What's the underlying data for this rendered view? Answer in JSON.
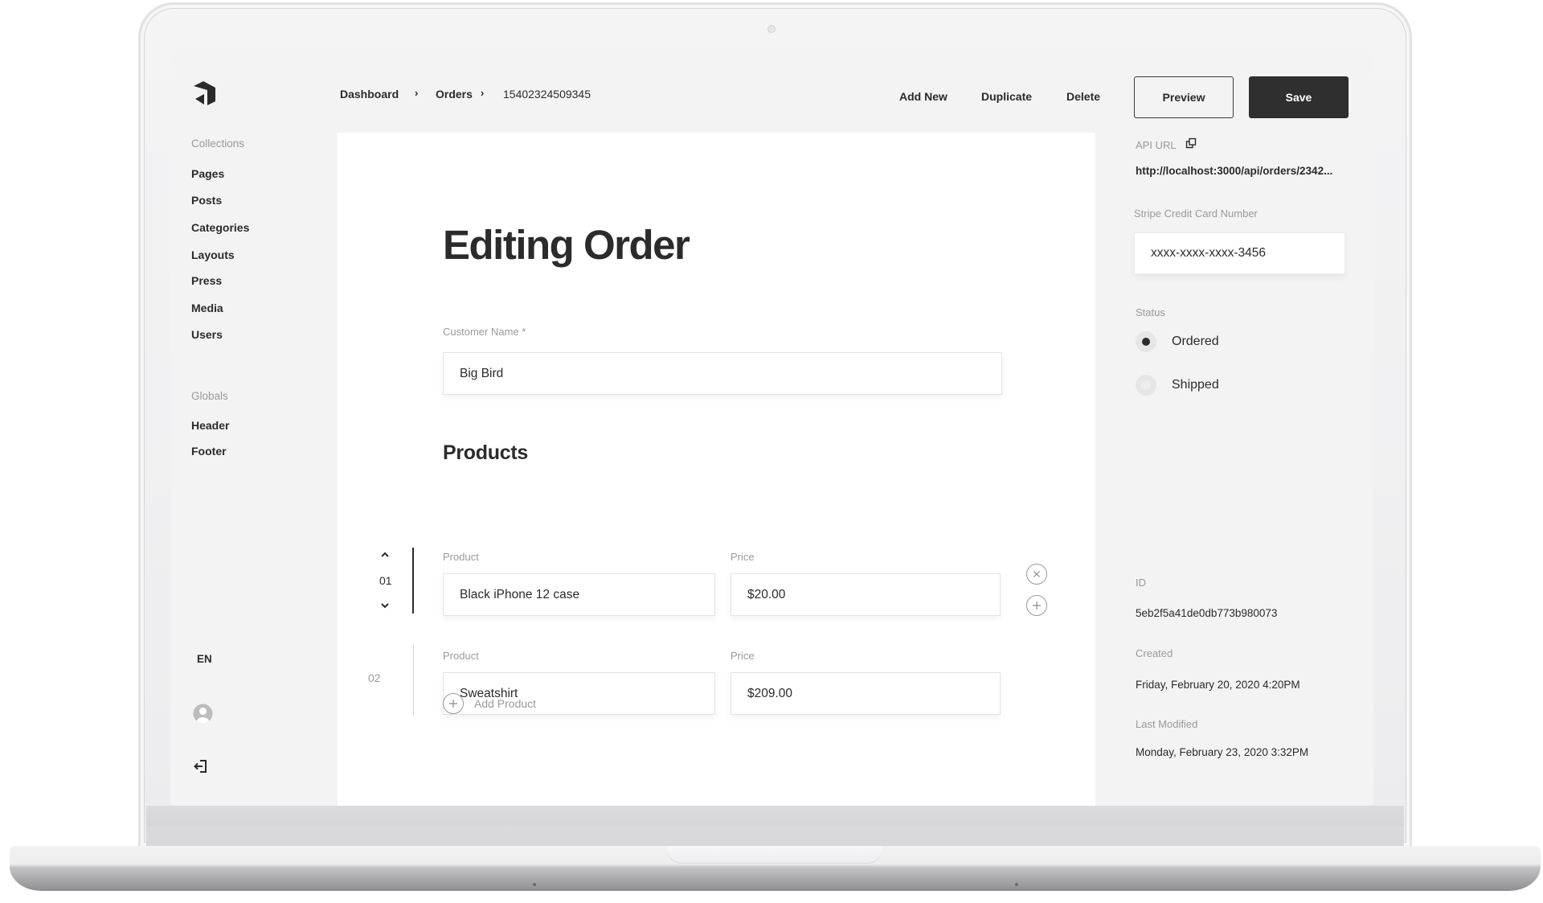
{
  "sidebar": {
    "collections_label": "Collections",
    "collections": [
      {
        "label": "Pages"
      },
      {
        "label": "Posts"
      },
      {
        "label": "Categories"
      },
      {
        "label": "Layouts"
      },
      {
        "label": "Press"
      },
      {
        "label": "Media"
      },
      {
        "label": "Users"
      }
    ],
    "globals_label": "Globals",
    "globals": [
      {
        "label": "Header"
      },
      {
        "label": "Footer"
      }
    ],
    "locale": "EN"
  },
  "breadcrumb": {
    "items": [
      "Dashboard",
      "Orders",
      "15402324509345"
    ],
    "separator": "›"
  },
  "toolbar": {
    "add_new": "Add New",
    "duplicate": "Duplicate",
    "delete": "Delete",
    "preview": "Preview",
    "save": "Save"
  },
  "main": {
    "title": "Editing Order",
    "customer_name": {
      "label": "Customer Name",
      "required_mark": "*",
      "value": "Big Bird"
    },
    "products_title": "Products",
    "products": [
      {
        "index": "01",
        "product_label": "Product",
        "product": "Black iPhone 12 case",
        "price_label": "Price",
        "price": "$20.00",
        "active": true
      },
      {
        "index": "02",
        "product_label": "Product",
        "product": "Sweatshirt",
        "price_label": "Price",
        "price": "$209.00",
        "active": false
      }
    ],
    "add_product": "Add Product"
  },
  "meta": {
    "api_url_label": "API URL",
    "api_url": "http://localhost:3000/api/orders/2342...",
    "card_label": "Stripe Credit Card Number",
    "card_value": "xxxx-xxxx-xxxx-3456",
    "status_label": "Status",
    "status_options": [
      {
        "label": "Ordered",
        "selected": true
      },
      {
        "label": "Shipped",
        "selected": false
      }
    ],
    "id_label": "ID",
    "id_value": "5eb2f5a41de0db773b980073",
    "created_label": "Created",
    "created_value": "Friday, February 20, 2020 4:20PM",
    "modified_label": "Last Modified",
    "modified_value": "Monday, February 23, 2020 3:32PM"
  },
  "colors": {
    "accent_dark": "#2f2f2f",
    "background": "#f3f3f3",
    "panel": "#ffffff",
    "muted_text": "#9a9a9a"
  }
}
